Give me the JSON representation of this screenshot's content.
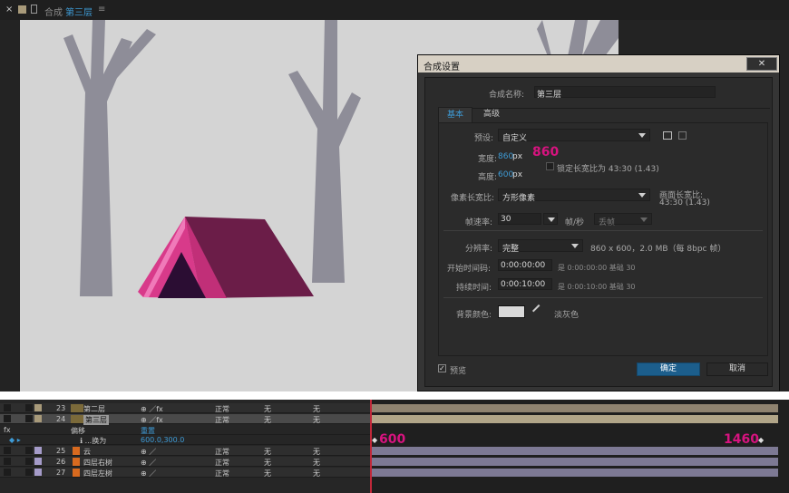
{
  "viewer": {
    "close_glyph": "×",
    "tab_prefix": "合成",
    "tab_name": "第三层",
    "menu_glyph": "≡"
  },
  "dialog": {
    "title": "合成设置",
    "close_glyph": "✕",
    "name_label": "合成名称:",
    "name_value": "第三层",
    "tabs": {
      "basic": "基本",
      "advanced": "高级"
    },
    "preset_label": "预设:",
    "preset_value": "自定义",
    "width_label": "宽度:",
    "width_value": "860",
    "height_label": "高度:",
    "height_value": "600",
    "px": "px",
    "lock_label": "锁定长宽比为 43:30 (1.43)",
    "pixel_aspect_label": "像素长宽比:",
    "pixel_aspect_value": "方形像素",
    "frame_aspect_label": "画面长宽比:",
    "frame_aspect_value": "43:30 (1.43)",
    "fps_label": "帧速率:",
    "fps_value": "30",
    "fps_unit": "帧/秒",
    "drop_frame": "丢帧",
    "resolution_label": "分辨率:",
    "resolution_value": "完整",
    "resolution_info": "860 x 600，2.0 MB（每 8bpc 帧）",
    "start_tc_label": "开始时间码:",
    "start_tc_value": "0:00:00:00",
    "start_tc_info": "是 0:00:00:00  基础 30",
    "duration_label": "持续时间:",
    "duration_value": "0:00:10:00",
    "duration_info": "是 0:00:10:00  基础 30",
    "bg_label": "背景颜色:",
    "bg_name": "淡灰色",
    "bg_color": "#d9d9d9",
    "preview_label": "预览",
    "ok_label": "确定",
    "cancel_label": "取消"
  },
  "annotations": {
    "width_note": "860",
    "start_note": "600",
    "end_note": "1460"
  },
  "timeline": {
    "rows": [
      {
        "num": "23",
        "name": "第二层",
        "mode": "正常",
        "trk": "无",
        "parent": "无",
        "color": "#a89a7a"
      },
      {
        "num": "24",
        "name": "第三层",
        "mode": "正常",
        "trk": "无",
        "parent": "无",
        "color": "#a89a7a"
      },
      {
        "num": "25",
        "name": "云",
        "mode": "正常",
        "trk": "无",
        "parent": "无",
        "color": "#a59bc9"
      },
      {
        "num": "26",
        "name": "四层右树",
        "mode": "正常",
        "trk": "无",
        "parent": "无",
        "color": "#a59bc9"
      },
      {
        "num": "27",
        "name": "四层左树",
        "mode": "正常",
        "trk": "无",
        "parent": "无",
        "color": "#a59bc9"
      }
    ],
    "offset_label": "偏移",
    "reset_label": "重置",
    "offset_value": "600.0,300.0",
    "fx_label": "fx",
    "sub_prop": "ℹ  ...换为"
  }
}
